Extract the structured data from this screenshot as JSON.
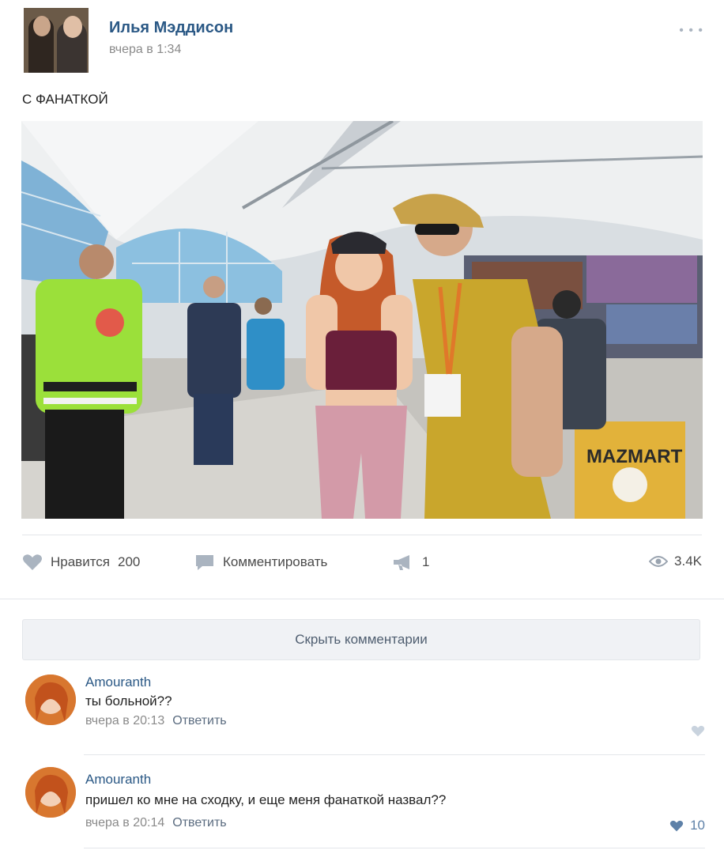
{
  "post": {
    "author": "Илья Мэддисон",
    "time": "вчера в 1:34",
    "text": "С ФАНАТКОЙ",
    "photo_banner": "MAZMART",
    "more_icon": "ellipsis-icon"
  },
  "actions": {
    "like_label": "Нравится",
    "like_count": "200",
    "comment_label": "Комментировать",
    "share_count": "1",
    "views": "3.4K"
  },
  "comments_toggle": "Скрыть комментарии",
  "comments": [
    {
      "author": "Amouranth",
      "text": "ты больной??",
      "time": "вчера в 20:13",
      "reply": "Ответить",
      "likes": ""
    },
    {
      "author": "Amouranth",
      "text": "пришел ко мне на сходку, и еще меня фанаткой назвал??",
      "time": "вчера в 20:14",
      "reply": "Ответить",
      "likes": "10"
    }
  ],
  "colors": {
    "link": "#2a5885",
    "like_active": "#5e81a8",
    "icon_gray": "#aab4c0"
  }
}
